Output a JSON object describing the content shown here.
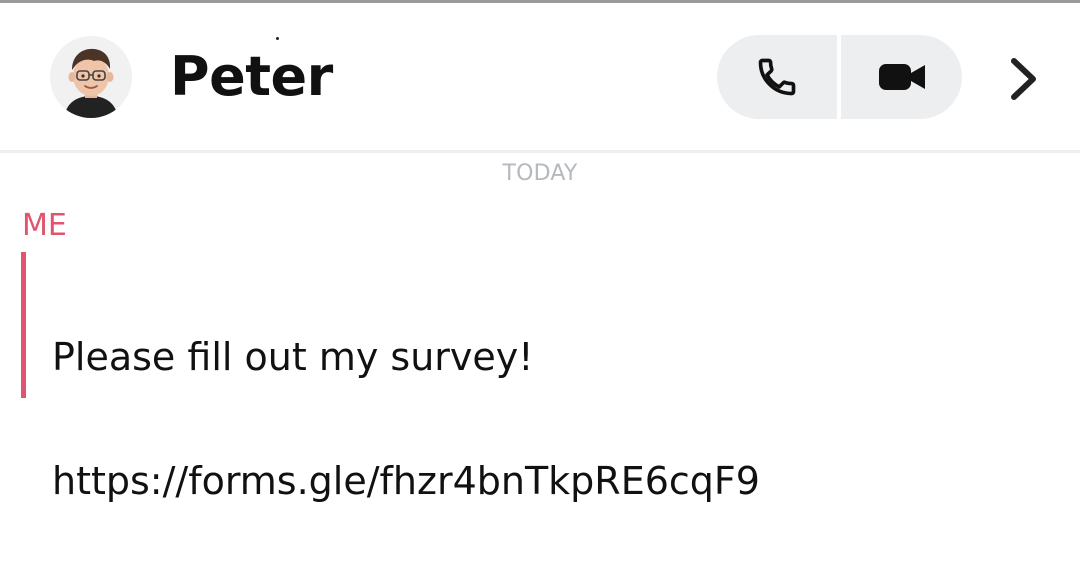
{
  "header": {
    "contact_name": "Peter",
    "avatar_icon": "bitmoji-avatar",
    "voice_call_icon": "phone-icon",
    "video_call_icon": "video-camera-icon",
    "chevron_icon": "chevron-right-icon"
  },
  "chat": {
    "day_label": "TODAY",
    "messages": [
      {
        "sender": "ME",
        "sender_color": "#e0546d",
        "lines": [
          "Please fill out my survey!",
          "https://forms.gle/fhzr4bnTkpRE6cqF9"
        ]
      }
    ]
  },
  "colors": {
    "accent": "#e0546d",
    "button_bg": "#edeef0",
    "muted_text": "#b5b9be"
  }
}
